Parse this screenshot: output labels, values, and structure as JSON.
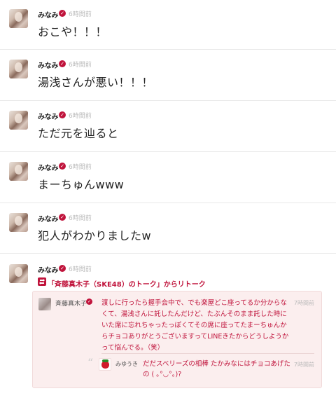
{
  "posts": [
    {
      "author": "みなみ",
      "time": "6時間前",
      "text": "おこや！！！"
    },
    {
      "author": "みなみ",
      "time": "6時間前",
      "text": "湯浅さんが悪い！！！"
    },
    {
      "author": "みなみ",
      "time": "6時間前",
      "text": "ただ元を辿ると"
    },
    {
      "author": "みなみ",
      "time": "6時間前",
      "text": "まーちゅんwww"
    },
    {
      "author": "みなみ",
      "time": "6時間前",
      "text": "犯人がわかりましたw"
    },
    {
      "author": "みなみ",
      "time": "6時間前",
      "text": ""
    }
  ],
  "retalk": {
    "label": "「斉藤真木子（SKE48）のトーク」からリトーク",
    "original": {
      "author": "斉藤真木子",
      "time": "7時間前",
      "text": "渡しに行ったら握手会中で、でも楽屋どこ座ってるか分からなくて、湯浅さんに託したんだけど、たぶんそのまま託した時にいた席に忘れちゃったっぽくてその席に座ってたまーちゅんからチョコありがとうございますってLINEきたからどうしようかって悩んでる。（笑）"
    },
    "reply": {
      "author": "みゆうき",
      "time": "7時間前",
      "text": "だだスベリーズの相棒 たかみなにはチョコあげたの ( ｡°◡°｡)?"
    }
  },
  "colors": {
    "accent": "#c0143c",
    "card_bg": "#fbeeee",
    "divider": "#e9e9e9",
    "time": "#bbbbbb"
  },
  "icons": {
    "verified": "check-badge-icon",
    "retalk": "retalk-icon",
    "quote": "quote-icon"
  }
}
